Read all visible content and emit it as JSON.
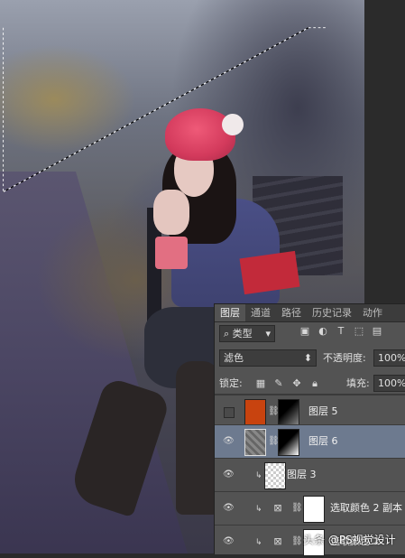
{
  "panel": {
    "tabs": [
      "图层",
      "通道",
      "路径",
      "历史记录",
      "动作"
    ],
    "filter_kind": "类型",
    "blend_mode": "滤色",
    "opacity_label": "不透明度:",
    "opacity_value": "100%",
    "lock_label": "锁定:",
    "fill_label": "填充:",
    "fill_value": "100%",
    "icons": [
      "search-icon",
      "image-filter-icon",
      "adjustment-filter-icon",
      "type-filter-icon",
      "shape-filter-icon",
      "smartobject-filter-icon",
      "lock-pixels-icon",
      "brush-icon",
      "move-icon",
      "lock-all-icon"
    ]
  },
  "layers": [
    {
      "name": "图层 5",
      "visible": false,
      "thumb_color": "#c8430f",
      "mask": "dark-gradient"
    },
    {
      "name": "图层 6",
      "visible": true,
      "selected": true,
      "thumb_color": "#777777",
      "mask": "dark-gradient"
    },
    {
      "name": "图层 3",
      "visible": true,
      "clipped": true,
      "thumb_color": "transparent"
    },
    {
      "name": "选取颜色 2 副本",
      "visible": true,
      "clipped": true,
      "adjustment": true
    },
    {
      "name": "选取颜色 2",
      "visible": true,
      "clipped": true,
      "adjustment": true
    }
  ],
  "watermark": "头条 @PS视觉设计"
}
